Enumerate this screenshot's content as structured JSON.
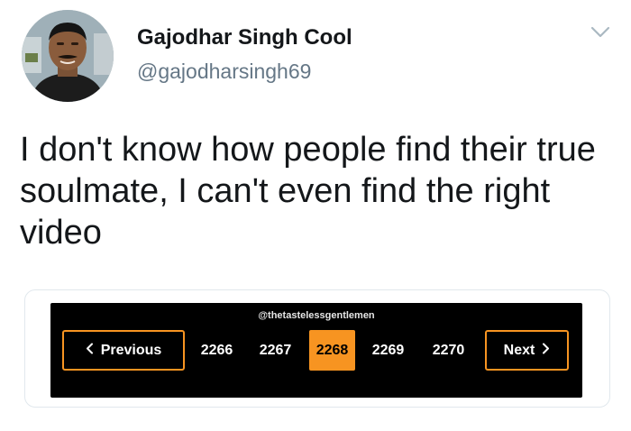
{
  "header": {
    "display_name": "Gajodhar Singh Cool",
    "handle": "@gajodharsingh69"
  },
  "tweet": {
    "text": "I don't know how people find their true soulmate, I can't even find the right video"
  },
  "media": {
    "watermark": "@thetastelessgentlemen",
    "pagination": {
      "previous_label": "Previous",
      "pages": [
        "2266",
        "2267",
        "2268",
        "2269",
        "2270"
      ],
      "current_page": "2268",
      "next_label": "Next"
    }
  },
  "colors": {
    "accent": "#f79421",
    "media_background": "#000000",
    "handle": "#657786"
  },
  "icons": {
    "menu": "chevron-down-icon",
    "previous": "chevron-left-icon",
    "next": "chevron-right-icon"
  }
}
